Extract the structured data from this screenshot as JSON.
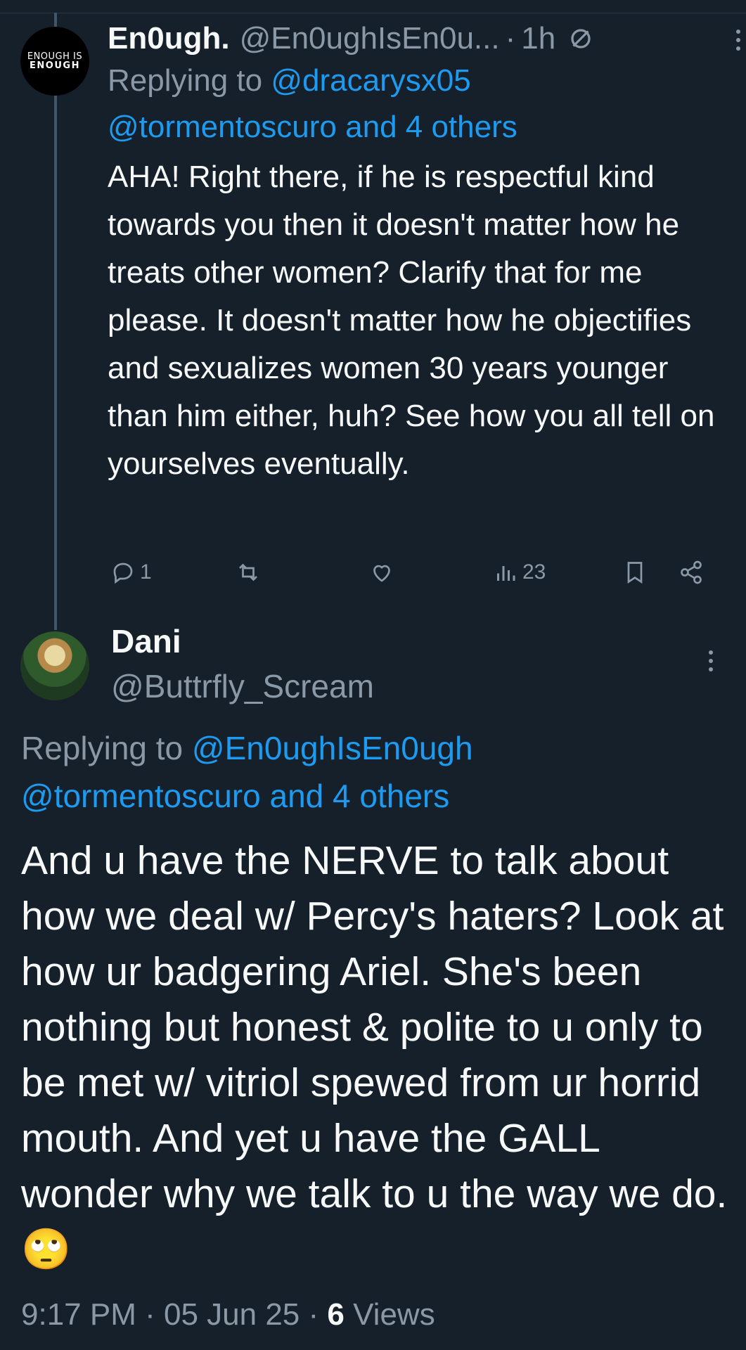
{
  "tweet1": {
    "avatar_text": [
      "ENOUGH IS",
      "ENOUGH"
    ],
    "name": "En0ugh.",
    "handle": "@En0ughIsEn0u...",
    "time": "1h",
    "replying_prefix": "Replying to",
    "reply_to_1": "@dracarysx05",
    "reply_to_2": "@tormentoscuro and 4 others",
    "body": "AHA! Right there, if he is respectful kind towards you then it doesn't matter how he treats other women? Clarify that for me please. It doesn't matter how he objectifies and sexualizes women 30 years younger than him either, huh? See how you all tell on yourselves eventually.",
    "reply_count": "1",
    "view_count": "23"
  },
  "tweet2": {
    "name": "Dani",
    "handle": "@Buttrfly_Scream",
    "replying_prefix": "Replying to",
    "reply_to_1": "@En0ughIsEn0ugh",
    "reply_to_2": "@tormentoscuro and 4 others",
    "body": "And u have the NERVE to talk about how we deal w/ Percy's haters? Look at how ur badgering Ariel. She's been nothing but honest & polite to u only to be met w/ vitriol spewed from ur horrid mouth. And yet u have the GALL wonder why we talk to u the way we do. 🙄",
    "time": "9:17 PM",
    "date": "05 Jun 25",
    "views_count": "6",
    "views_label": "Views"
  },
  "colors": {
    "background": "#15202b",
    "text": "#f7f9f9",
    "muted": "#8b98a5",
    "link": "#1d9bf0"
  }
}
